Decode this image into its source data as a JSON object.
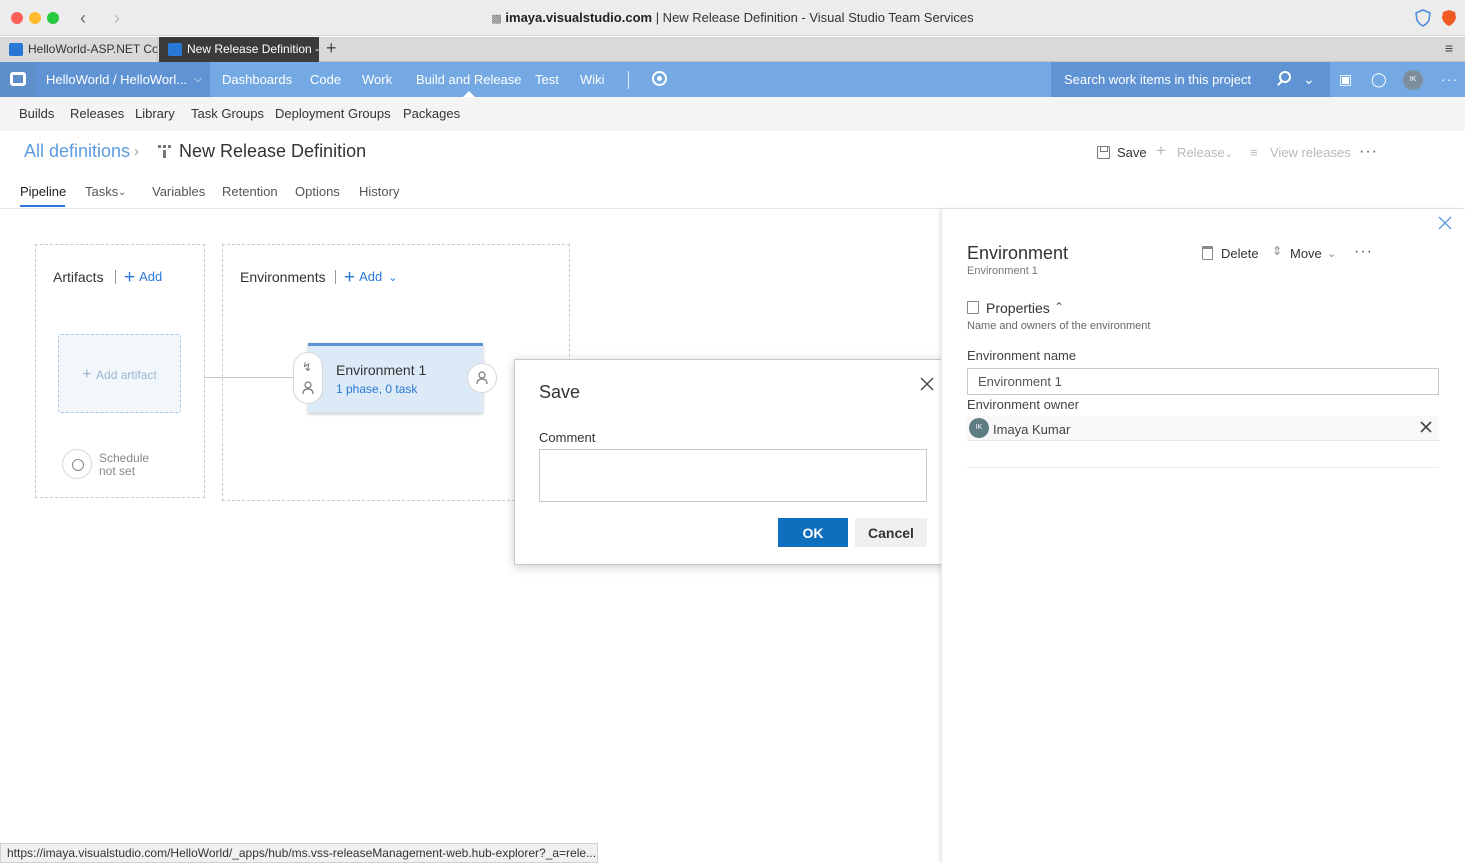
{
  "browser": {
    "address_host": "imaya.visualstudio.com",
    "address_rest": " | New Release Definition - Visual Studio Team Services",
    "tabs": [
      {
        "label": "HelloWorld-ASP.NET Co"
      },
      {
        "label": "New Release Definition -"
      }
    ],
    "new_tab": "+",
    "menu": "≡"
  },
  "vsts": {
    "project": "HelloWorld / HelloWorl...",
    "nav": [
      {
        "label": "Dashboards"
      },
      {
        "label": "Code"
      },
      {
        "label": "Work"
      },
      {
        "label": "Build and Release"
      },
      {
        "label": "Test"
      },
      {
        "label": "Wiki"
      }
    ],
    "search_placeholder": "Search work items in this project",
    "avatar_initials": "IK"
  },
  "subnav": [
    {
      "label": "Builds"
    },
    {
      "label": "Releases"
    },
    {
      "label": "Library"
    },
    {
      "label": "Task Groups"
    },
    {
      "label": "Deployment Groups"
    },
    {
      "label": "Packages"
    }
  ],
  "header": {
    "breadcrumb_root": "All definitions",
    "title": "New Release Definition",
    "save_label": "Save",
    "release_label": "Release",
    "view_releases_label": "View releases"
  },
  "page_tabs": [
    {
      "label": "Pipeline"
    },
    {
      "label": "Tasks"
    },
    {
      "label": "Variables"
    },
    {
      "label": "Retention"
    },
    {
      "label": "Options"
    },
    {
      "label": "History"
    }
  ],
  "pipeline": {
    "artifacts_label": "Artifacts",
    "artifacts_add": "Add",
    "add_artifact": "Add artifact",
    "schedule_line1": "Schedule",
    "schedule_line2": "not set",
    "environments_label": "Environments",
    "environments_add": "Add",
    "env_card_title": "Environment 1",
    "env_card_sub": "1 phase, 0 task"
  },
  "dialog": {
    "title": "Save",
    "comment_label": "Comment",
    "comment_value": "",
    "ok": "OK",
    "cancel": "Cancel"
  },
  "panel": {
    "title": "Environment",
    "subtitle": "Environment 1",
    "delete_label": "Delete",
    "move_label": "Move",
    "properties_title": "Properties",
    "properties_desc": "Name and owners of the environment",
    "env_name_label": "Environment name",
    "env_name_value": "Environment 1",
    "env_owner_label": "Environment owner",
    "owner_initials": "IK",
    "owner_name": "Imaya Kumar"
  },
  "status_url": "https://imaya.visualstudio.com/HelloWorld/_apps/hub/ms.vss-releaseManagement-web.hub-explorer?_a=rele...",
  "colors": {
    "accent": "#2a78d6",
    "top_bar": "#74a9e4",
    "ok_button": "#106ebe"
  }
}
